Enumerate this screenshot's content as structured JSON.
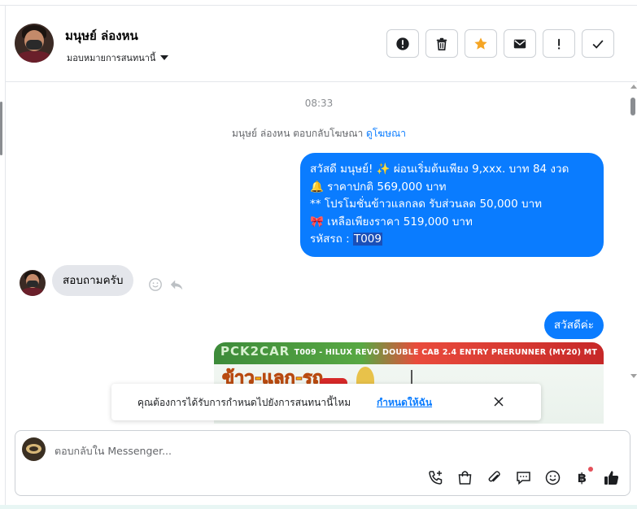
{
  "header": {
    "contact_name": "มนุษย์ ล่องหน",
    "assign_label": "มอบหมายการสนทนานี้",
    "actions": [
      {
        "name": "report-spam-button",
        "icon": "exclamation-circle-icon"
      },
      {
        "name": "delete-button",
        "icon": "trash-icon"
      },
      {
        "name": "star-button",
        "icon": "star-icon"
      },
      {
        "name": "mark-unread-button",
        "icon": "envelope-icon"
      },
      {
        "name": "follow-up-button",
        "icon": "exclamation-icon"
      },
      {
        "name": "mark-done-button",
        "icon": "check-icon"
      }
    ]
  },
  "conversation": {
    "timestamp": "08:33",
    "ad_reply": {
      "text": "มนุษย์ ล่องหน ตอบกลับโฆษณา",
      "link": "ดูโฆษณา"
    },
    "outgoing_message": {
      "line1": "สวัสดี มนุษย์! ✨  ผ่อนเริ่มต้นเพียง 9,xxx. บาท 84 งวด",
      "line2": "🔔 ราคาปกติ 569,000 บาท",
      "line3": "** โปรโมชั่นข้าวแลกลด รับส่วนลด 50,000 บาท",
      "line4": "🎀  เหลือเพียงราคา 519,000 บาท",
      "line5_prefix": " รหัสรถ : ",
      "line5_code": "T009"
    },
    "incoming_message": "สอบถามครับ",
    "outgoing_message2": "สวัสดีค่ะ",
    "ad_image": {
      "logo_text": "PCK2CAR",
      "strip_text": "T009 - HILUX REVO DOUBLE CAB 2.4 ENTRY PRERUNNER (MY20) MT",
      "promo_text": "ข้าว-แลก-รถ"
    }
  },
  "notice": {
    "text": "คุณต้องการได้รับการกำหนดไปยังการสนทนานี้ไหม",
    "link": "กำหนดให้ฉัน"
  },
  "composer": {
    "placeholder": "ตอบกลับใน Messenger...",
    "tools": [
      "phone-plus-icon",
      "shopping-bag-icon",
      "paperclip-icon",
      "chat-bubble-icon",
      "emoji-icon",
      "baht-payment-icon",
      "thumbs-up-icon"
    ],
    "baht_symbol": "฿"
  },
  "colors": {
    "messenger_blue": "#0a7cff",
    "incoming_bubble": "#e4e6eb",
    "star_orange": "#f5a524"
  }
}
